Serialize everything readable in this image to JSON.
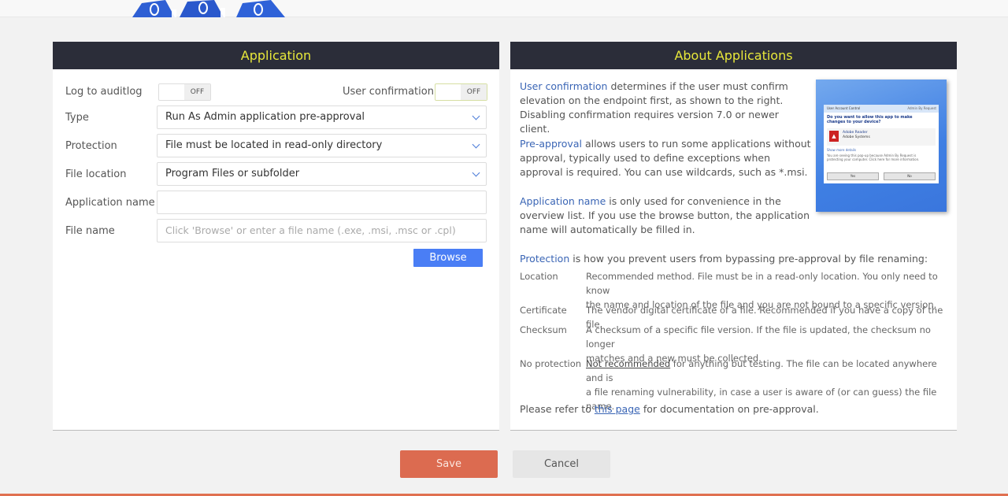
{
  "left_panel": {
    "title": "Application",
    "log_to_auditlog": {
      "label": "Log to auditlog",
      "state": "OFF"
    },
    "user_confirmation": {
      "label": "User confirmation",
      "state": "OFF"
    },
    "type": {
      "label": "Type",
      "value": "Run As Admin application pre-approval"
    },
    "protection": {
      "label": "Protection",
      "value": "File must be located in read-only directory"
    },
    "file_location": {
      "label": "File location",
      "value": "Program Files or subfolder"
    },
    "application_name": {
      "label": "Application name",
      "value": ""
    },
    "file_name": {
      "label": "File name",
      "placeholder": "Click 'Browse' or enter a file name (.exe, .msi, .msc or .cpl)"
    },
    "browse_label": "Browse"
  },
  "right_panel": {
    "title": "About Applications",
    "user_confirmation": {
      "term": "User confirmation",
      "text": [
        " determines if the user must confirm",
        "elevation on the endpoint first, as shown to the right.",
        "Disabling confirmation requires version 7.0 or newer client."
      ]
    },
    "pre_approval": {
      "term": "Pre-approval",
      "text": [
        " allows users to run some applications without",
        "approval, typically used to define exceptions when",
        "approval is required. You can use wildcards, such as *.msi."
      ]
    },
    "application_name": {
      "term": "Application name",
      "text": [
        " is only used for convenience in the",
        "overview list. If you use the browse button, the application",
        "name will automatically be filled in."
      ]
    },
    "protection": {
      "term": "Protection",
      "text": " is how you prevent users from bypassing pre-approval by file renaming:"
    },
    "protection_types": [
      {
        "term": "Location",
        "desc": [
          "Recommended method. File must be in a read-only location. You only need to know",
          "the name and location of the file and you are not bound to a specific version."
        ]
      },
      {
        "term": "Certificate",
        "desc": [
          "The vendor digital certificate of a file. Recommended if you have a copy of the file."
        ]
      },
      {
        "term": "Checksum",
        "desc": [
          "A checksum of a specific file version. If the file is updated, the checksum no longer",
          "matches and a new must be collected."
        ]
      },
      {
        "term": "No protection",
        "desc_link": "Not recommended",
        "desc": [
          " for anything but testing. The file can be located anywhere and is",
          "a file renaming vulnerability, in case a user is aware of (or can guess) the file name."
        ]
      }
    ],
    "footer": {
      "prefix": "Please refer to ",
      "link": "this page",
      "suffix": " for documentation on pre-approval."
    },
    "uac_image": {
      "title": "User Account Control",
      "brand": "Admin By Request",
      "question": [
        "Do you want to allow this app to make",
        "changes to your device?"
      ],
      "app_name": "Adobe Reader",
      "app_publisher": "Adobe Systems",
      "show_details": "Show more details",
      "message": [
        "You are seeing this pop-up because Admin By Request is",
        "protecting your computer. Click here for more information."
      ],
      "yes": "Yes",
      "no": "No"
    }
  },
  "actions": {
    "save": "Save",
    "cancel": "Cancel"
  }
}
